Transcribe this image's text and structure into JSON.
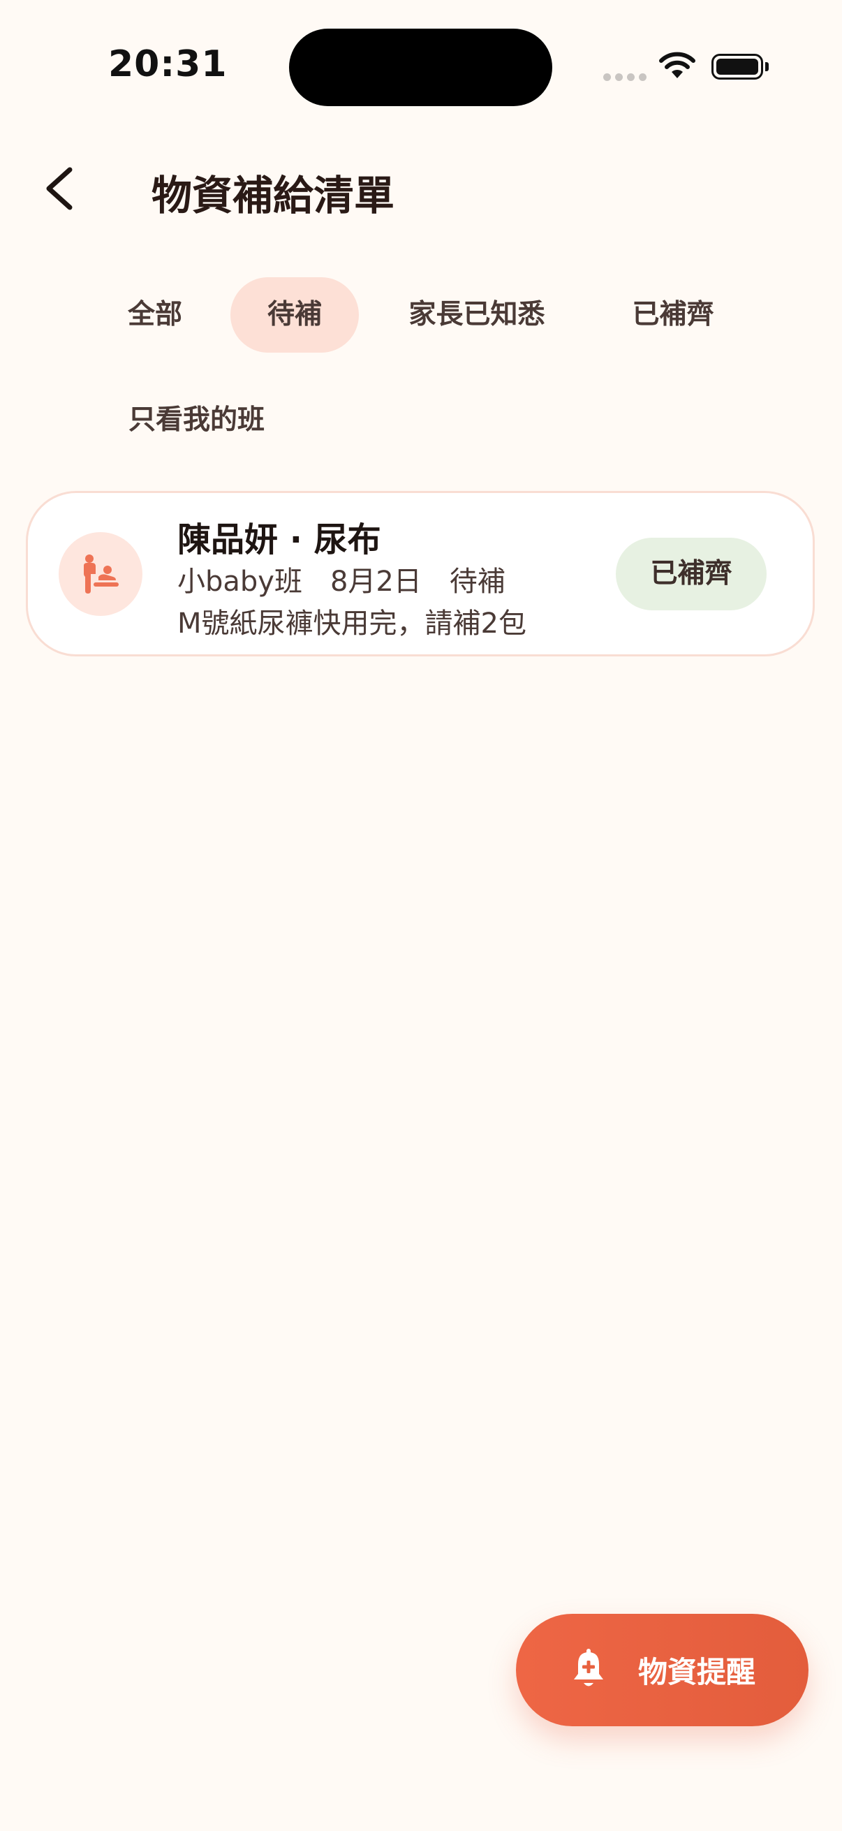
{
  "status_bar": {
    "time": "20:31"
  },
  "header": {
    "title": "物資補給清單"
  },
  "tabs": [
    {
      "label": "全部",
      "active": false
    },
    {
      "label": "待補",
      "active": true
    },
    {
      "label": "家長已知悉",
      "active": false
    },
    {
      "label": "已補齊",
      "active": false
    }
  ],
  "filter": {
    "label": "只看我的班"
  },
  "items": [
    {
      "title": "陳品妍 · 尿布",
      "meta": "小baby班　8月2日　待補",
      "note": "M號紙尿褲快用完，請補2包",
      "action": "已補齊",
      "icon": "baby-changing-icon"
    }
  ],
  "fab": {
    "label": "物資提醒",
    "icon": "bell-plus-icon"
  },
  "colors": {
    "accent": "#E8613F",
    "active_tab_bg": "#FDE0D6",
    "done_bg": "#E7F1E2",
    "background": "#FFFAF5"
  }
}
